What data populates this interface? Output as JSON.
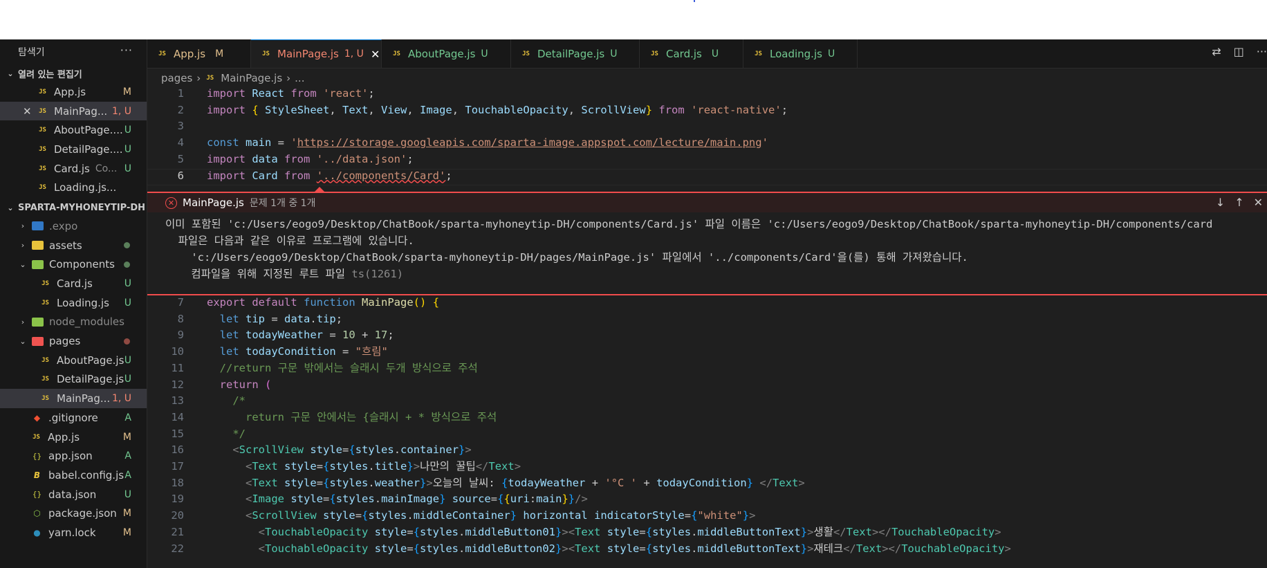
{
  "explorer": {
    "title": "탐색기",
    "open_editors_label": "열려 있는 편집기",
    "open_editors": [
      {
        "name": "App.js",
        "badge": "M",
        "state": "mod"
      },
      {
        "name": "MainPag...",
        "badge": "1, U",
        "state": "err"
      },
      {
        "name": "AboutPage....",
        "badge": "U",
        "state": "new"
      },
      {
        "name": "DetailPage....",
        "badge": "U",
        "state": "new"
      },
      {
        "name": "Card.js",
        "desc": "Co...",
        "badge": "U",
        "state": "new"
      },
      {
        "name": "Loading.js...",
        "badge": "",
        "state": "new"
      }
    ],
    "project_label": "SPARTA-MYHONEYTIP-DH",
    "tree": [
      {
        "name": ".expo",
        "badge": ""
      },
      {
        "name": "assets",
        "badge": "●"
      },
      {
        "name": "Components",
        "badge": "●"
      },
      {
        "name": "Card.js",
        "badge": "U"
      },
      {
        "name": "Loading.js",
        "badge": "U"
      },
      {
        "name": "node_modules",
        "badge": ""
      },
      {
        "name": "pages",
        "badge": "●"
      },
      {
        "name": "AboutPage.js",
        "badge": "U"
      },
      {
        "name": "DetailPage.js",
        "badge": "U"
      },
      {
        "name": "MainPag...",
        "badge": "1, U"
      },
      {
        "name": ".gitignore",
        "badge": "A"
      },
      {
        "name": "App.js",
        "badge": "M"
      },
      {
        "name": "app.json",
        "badge": "A"
      },
      {
        "name": "babel.config.js",
        "badge": "A"
      },
      {
        "name": "data.json",
        "badge": "U"
      },
      {
        "name": "package.json",
        "badge": "M"
      },
      {
        "name": "yarn.lock",
        "badge": "M"
      }
    ]
  },
  "tabs": [
    {
      "label": "App.js",
      "status": "M"
    },
    {
      "label": "MainPage.js",
      "status": "1, U"
    },
    {
      "label": "AboutPage.js",
      "status": "U"
    },
    {
      "label": "DetailPage.js",
      "status": "U"
    },
    {
      "label": "Card.js",
      "status": "U"
    },
    {
      "label": "Loading.js",
      "status": "U"
    }
  ],
  "breadcrumb": {
    "folder": "pages",
    "file": "MainPage.js",
    "tail": "..."
  },
  "problem": {
    "file": "MainPage.js",
    "count": "문제 1개 중 1개",
    "line1": "이미 포함된 'c:/Users/eogo9/Desktop/ChatBook/sparta-myhoneytip-DH/components/Card.js' 파일 이름은 'c:/Users/eogo9/Desktop/ChatBook/sparta-myhoneytip-DH/components/card",
    "line2": "  파일은 다음과 같은 이유로 프로그램에 있습니다.",
    "line3": "    'c:/Users/eogo9/Desktop/ChatBook/sparta-myhoneytip-DH/pages/MainPage.js' 파일에서 '../components/Card'을(를) 통해 가져왔습니다.",
    "line4": "    컴파일을 위해 지정된 루트 파일",
    "code": "ts(1261)"
  },
  "line_numbers_top": [
    "1",
    "2",
    "3",
    "4",
    "5",
    "6"
  ],
  "line_numbers_bottom": [
    "7",
    "8",
    "9",
    "10",
    "11",
    "12",
    "13",
    "14",
    "15",
    "16",
    "17",
    "18",
    "19",
    "20",
    "21",
    "22"
  ]
}
